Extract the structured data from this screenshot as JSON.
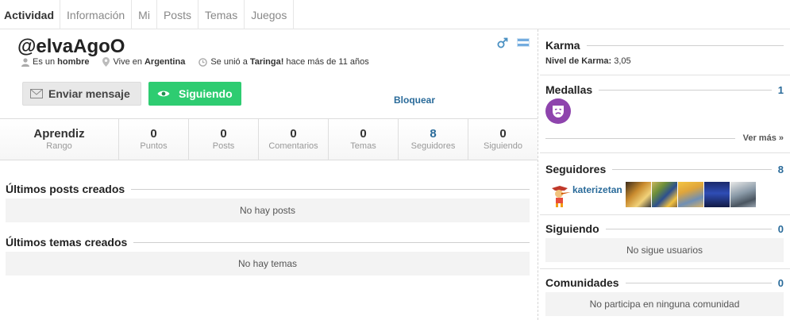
{
  "tabs": [
    {
      "label": "Actividad"
    },
    {
      "label": "Información"
    },
    {
      "label": "Mi"
    },
    {
      "label": "Posts"
    },
    {
      "label": "Temas"
    },
    {
      "label": "Juegos"
    }
  ],
  "profile": {
    "username": "@elvaAgoO",
    "gender_prefix": "Es un",
    "gender_value": "hombre",
    "location_prefix": "Vive en",
    "location_value": "Argentina",
    "joined_prefix": "Se unió a",
    "joined_site": "Taringa!",
    "joined_suffix": "hace más de 11 años",
    "gender_icon": "male-icon",
    "flag_icon": "argentina-flag-icon"
  },
  "actions": {
    "message_label": "Enviar mensaje",
    "follow_label": "Siguiendo",
    "block_label": "Bloquear"
  },
  "stats": [
    {
      "value": "Aprendiz",
      "label": "Rango"
    },
    {
      "value": "0",
      "label": "Puntos"
    },
    {
      "value": "0",
      "label": "Posts"
    },
    {
      "value": "0",
      "label": "Comentarios"
    },
    {
      "value": "0",
      "label": "Temas"
    },
    {
      "value": "8",
      "label": "Seguidores"
    },
    {
      "value": "0",
      "label": "Siguiendo"
    }
  ],
  "sections": {
    "posts_title": "Últimos posts creados",
    "posts_empty": "No hay posts",
    "topics_title": "Últimos temas creados",
    "topics_empty": "No hay temas"
  },
  "sidebar": {
    "karma_title": "Karma",
    "karma_level_label": "Nivel de Karma:",
    "karma_level_value": "3,05",
    "medals_title": "Medallas",
    "medals_count": "1",
    "see_more": "Ver más »",
    "followers_title": "Seguidores",
    "followers_count": "8",
    "followers_names": "katerizetan",
    "following_title": "Siguiendo",
    "following_count": "0",
    "following_empty": "No sigue usuarios",
    "communities_title": "Comunidades",
    "communities_count": "0",
    "communities_empty": "No participa en ninguna comunidad"
  },
  "colors": {
    "accent_link": "#2a6b9a",
    "follow_button": "#2ecc71",
    "medal": "#8e44ad"
  }
}
